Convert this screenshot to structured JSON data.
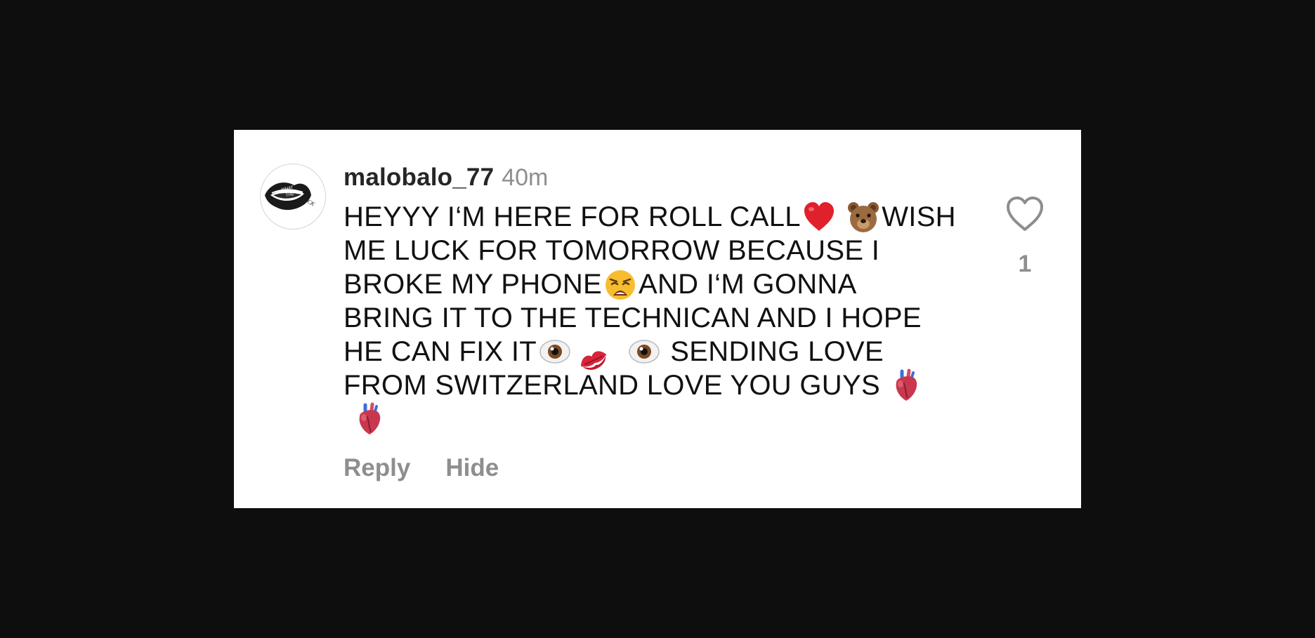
{
  "comment": {
    "username": "malobalo_77",
    "time": "40m",
    "lines": [
      [
        "HEYYY I‘M HERE FOR ROLL CALL",
        "red-heart-emoji",
        " ",
        "bear-emoji",
        "WISH"
      ],
      [
        "ME LUCK FOR TOMORROW BECAUSE I"
      ],
      [
        "BROKE MY PHONE",
        "weary-face-emoji",
        "AND I‘M GONNA"
      ],
      [
        "BRING IT TO THE TECHNICAN AND I HOPE"
      ],
      [
        "HE CAN FIX IT",
        "eye-emoji",
        " ",
        "kiss-mark-emoji",
        " ",
        "eye-emoji",
        " SENDING LOVE"
      ],
      [
        "FROM SWITZERLAND LOVE YOU GUYS ",
        "anatomical-heart-emoji"
      ],
      [
        " ",
        "anatomical-heart-emoji"
      ]
    ],
    "avatar_icon": "lips-avatar-icon",
    "avatar_text": [
      "WHAT",
      "THE",
      "F*CK"
    ],
    "like_icon": "heart-outline-icon",
    "like_count": "1",
    "reply_label": "Reply",
    "hide_label": "Hide"
  },
  "colors": {
    "background": "#0e0e0e",
    "card": "#ffffff",
    "text": "#111111",
    "muted": "#8e8e8e"
  }
}
